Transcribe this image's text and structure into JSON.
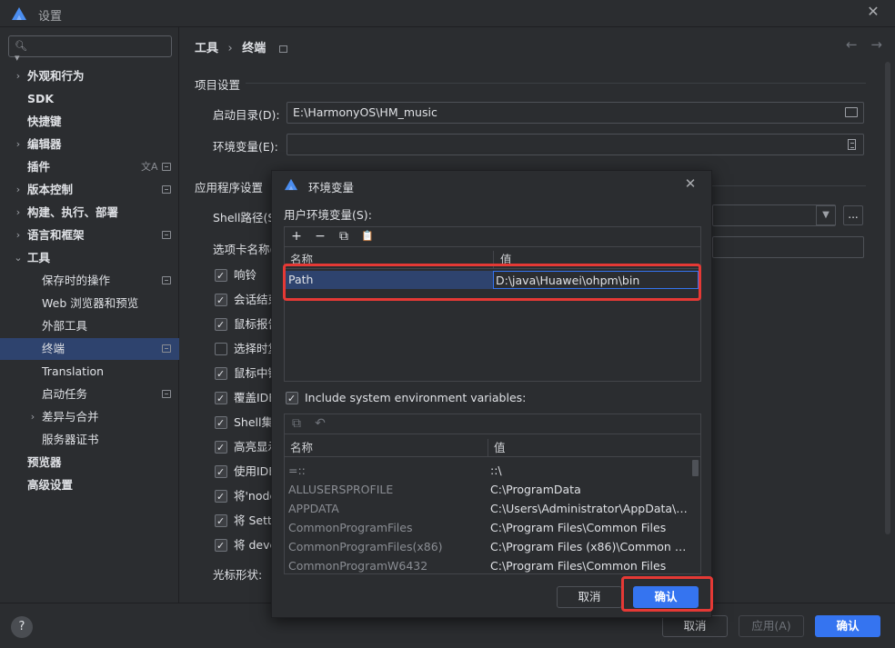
{
  "window": {
    "title": "设置",
    "close_glyph": "✕"
  },
  "sidebar": {
    "search_placeholder": "",
    "items": [
      {
        "label": "外观和行为",
        "has_chevron": true,
        "bold": true
      },
      {
        "label": "SDK",
        "bold": true
      },
      {
        "label": "快捷键",
        "bold": true
      },
      {
        "label": "编辑器",
        "has_chevron": true,
        "bold": true
      },
      {
        "label": "插件",
        "bold": true
      },
      {
        "label": "版本控制",
        "has_chevron": true,
        "bold": true
      },
      {
        "label": "构建、执行、部署",
        "has_chevron": true,
        "bold": true
      },
      {
        "label": "语言和框架",
        "has_chevron": true,
        "bold": true
      },
      {
        "label": "工具",
        "expanded": true,
        "bold": true
      },
      {
        "label": "保存时的操作"
      },
      {
        "label": "Web 浏览器和预览"
      },
      {
        "label": "外部工具"
      },
      {
        "label": "终端",
        "selected": true
      },
      {
        "label": "Translation"
      },
      {
        "label": "启动任务"
      },
      {
        "label": "差异与合并",
        "has_chevron": true
      },
      {
        "label": "服务器证书"
      },
      {
        "label": "预览器",
        "bold": true
      },
      {
        "label": "高级设置",
        "bold": true
      }
    ],
    "translate_glyph": "文A"
  },
  "main": {
    "breadcrumb": {
      "parent": "工具",
      "separator": "›",
      "current": "终端"
    },
    "nav": {
      "back": "←",
      "forward": "→"
    },
    "project_section": "项目设置",
    "start_dir_label": "启动目录(D):",
    "start_dir_value": "E:\\HarmonyOS\\HM_music",
    "env_label": "环境变量(E):",
    "env_value": "",
    "app_section": "应用程序设置",
    "shell_label": "Shell路径(S)",
    "tab_name_label": "选项卡名称(",
    "ellipsis": "...",
    "dropdown": "▼",
    "checkboxes": [
      {
        "label": "响铃",
        "checked": true
      },
      {
        "label": "会话结束",
        "checked": true
      },
      {
        "label": "鼠标报告",
        "checked": true
      },
      {
        "label": "选择时复",
        "checked": false
      },
      {
        "label": "鼠标中键",
        "checked": true
      },
      {
        "label": "覆盖IDE",
        "checked": true
      },
      {
        "label": "Shell集成",
        "checked": true
      },
      {
        "label": "高亮显示",
        "checked": true
      },
      {
        "label": "使用IDE",
        "checked": true
      },
      {
        "label": "将'node",
        "checked": true
      },
      {
        "label": "将 Setti",
        "checked": true
      },
      {
        "label": "将 deve",
        "checked": true
      }
    ],
    "cursor_label": "光标形状:"
  },
  "footer": {
    "help": "?",
    "cancel": "取消",
    "apply": "应用(A)",
    "ok": "确认"
  },
  "dialog": {
    "title": "环境变量",
    "close_glyph": "✕",
    "user_vars_label": "用户环境变量(S):",
    "toolbar": {
      "add": "+",
      "remove": "−",
      "copy": "⧉",
      "paste": "📋"
    },
    "columns": {
      "name": "名称",
      "value": "值"
    },
    "user_vars": [
      {
        "name": "Path",
        "value": "D:\\java\\Huawei\\ohpm\\bin"
      }
    ],
    "include_system_label": "Include system environment variables:",
    "include_system_checked": true,
    "sys_toolbar": {
      "copy": "⧉",
      "undo": "↶"
    },
    "system_vars": [
      {
        "name": "=::",
        "value": "::\\"
      },
      {
        "name": "ALLUSERSPROFILE",
        "value": "C:\\ProgramData"
      },
      {
        "name": "APPDATA",
        "value": "C:\\Users\\Administrator\\AppData\\R..."
      },
      {
        "name": "CommonProgramFiles",
        "value": "C:\\Program Files\\Common Files"
      },
      {
        "name": "CommonProgramFiles(x86)",
        "value": "C:\\Program Files (x86)\\Common Files"
      },
      {
        "name": "CommonProgramW6432",
        "value": "C:\\Program Files\\Common Files"
      }
    ],
    "cancel": "取消",
    "ok": "确认"
  },
  "colors": {
    "accent": "#3574f0",
    "selection": "#2e436e",
    "highlight_box": "#e53935"
  }
}
